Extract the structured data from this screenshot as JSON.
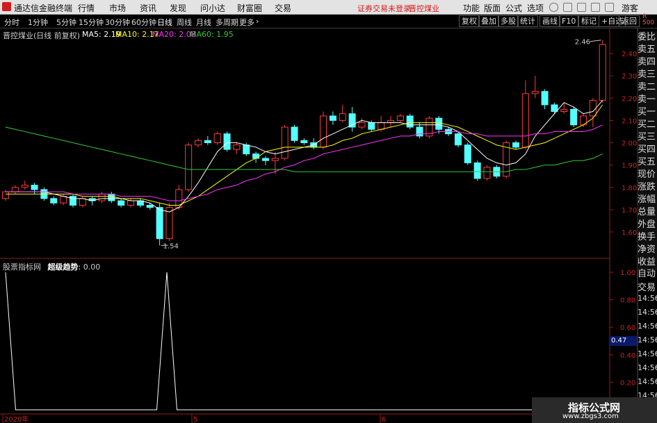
{
  "app": {
    "title": "通达信金融终端",
    "notice": "证券交易未登录",
    "stock_link": "晋控煤业"
  },
  "menu": [
    "行情",
    "市场",
    "资讯",
    "发现",
    "问小达",
    "财富圈",
    "交易"
  ],
  "menu_right": [
    "功能",
    "版面",
    "公式",
    "选项",
    "游客"
  ],
  "periods": [
    "分时",
    "1分钟",
    "5分钟",
    "15分钟",
    "30分钟",
    "60分钟",
    "日线",
    "周线",
    "月线",
    "多周期",
    "更多"
  ],
  "tools": [
    "复权",
    "叠加",
    "多股",
    "统计",
    "画线",
    "F10",
    "标记",
    "+自选",
    "返回"
  ],
  "rank": {
    "letter": "R",
    "num": "500"
  },
  "chart": {
    "title": "晋控煤业(日线 前复权)",
    "ma": [
      {
        "label": "MA5: 2.19",
        "color": "#ffffff"
      },
      {
        "label": "MA10: 2.17",
        "color": "#ffff00"
      },
      {
        "label": "MA20: 2.08",
        "color": "#ff33ff"
      },
      {
        "label": "MA60: 1.95",
        "color": "#33cc33"
      }
    ],
    "price_axis": [
      "2.40",
      "2.30",
      "2.20",
      "2.10",
      "2.00",
      "1.90",
      "1.80",
      "1.70",
      "1.60"
    ],
    "high_label": "2.46",
    "low_label": "1.54",
    "x_labels": [
      "2020年",
      "5",
      "6"
    ]
  },
  "indicator": {
    "title": "股票指标网",
    "name": "超级趋势",
    "value": "0.00",
    "axis": [
      "1.00",
      "0.80",
      "0.60",
      "0.40",
      "0.20"
    ],
    "cursor_value": "0.47",
    "values": [
      1,
      0,
      0,
      0,
      0,
      0,
      0,
      0,
      0,
      0,
      0,
      0,
      0,
      0,
      0,
      0,
      1,
      0,
      0,
      0,
      0,
      0,
      0,
      0,
      0,
      0,
      0,
      0,
      0,
      0,
      0,
      0,
      0,
      0,
      0,
      0,
      0,
      0,
      0,
      0,
      0,
      0,
      0,
      0,
      0,
      0,
      0,
      0,
      0,
      0,
      0,
      0,
      0,
      0,
      0,
      0,
      0,
      0
    ]
  },
  "side_panel": [
    "委比",
    "卖五",
    "卖四",
    "卖三",
    "卖二",
    "卖一",
    "买一",
    "买二",
    "买三",
    "买四",
    "买五",
    "现价",
    "涨跌",
    "涨幅",
    "总量",
    "外盘",
    "换手",
    "净资",
    "收益"
  ],
  "trade_panel": {
    "labels": [
      "自动",
      "交易"
    ],
    "times": [
      "14:56",
      "14:56",
      "14:56",
      "14:56",
      "14:56",
      "14:56",
      "14:56",
      "14:56"
    ]
  },
  "watermark": {
    "title": "指标公式网",
    "url": "www.zbgs3.com"
  },
  "chart_data": {
    "type": "candlestick",
    "ylim": [
      1.54,
      2.46
    ],
    "candles": [
      [
        1.75,
        1.78,
        1.79,
        1.74
      ],
      [
        1.78,
        1.8,
        1.81,
        1.77
      ],
      [
        1.8,
        1.81,
        1.83,
        1.79
      ],
      [
        1.81,
        1.79,
        1.82,
        1.77
      ],
      [
        1.79,
        1.75,
        1.8,
        1.74
      ],
      [
        1.75,
        1.73,
        1.76,
        1.72
      ],
      [
        1.73,
        1.76,
        1.77,
        1.72
      ],
      [
        1.76,
        1.72,
        1.77,
        1.71
      ],
      [
        1.72,
        1.75,
        1.76,
        1.71
      ],
      [
        1.75,
        1.74,
        1.76,
        1.72
      ],
      [
        1.74,
        1.77,
        1.78,
        1.73
      ],
      [
        1.77,
        1.74,
        1.78,
        1.73
      ],
      [
        1.74,
        1.72,
        1.75,
        1.71
      ],
      [
        1.72,
        1.74,
        1.75,
        1.71
      ],
      [
        1.74,
        1.72,
        1.75,
        1.71
      ],
      [
        1.72,
        1.71,
        1.73,
        1.7
      ],
      [
        1.71,
        1.57,
        1.73,
        1.54
      ],
      [
        1.57,
        1.71,
        1.73,
        1.56
      ],
      [
        1.71,
        1.79,
        1.81,
        1.7
      ],
      [
        1.79,
        1.99,
        2.0,
        1.78
      ],
      [
        1.99,
        2.01,
        2.02,
        1.98
      ],
      [
        2.01,
        2.0,
        2.03,
        1.99
      ],
      [
        2.0,
        2.04,
        2.05,
        1.99
      ],
      [
        2.04,
        1.97,
        2.05,
        1.96
      ],
      [
        1.97,
        1.99,
        2.0,
        1.95
      ],
      [
        1.99,
        1.95,
        2.0,
        1.94
      ],
      [
        1.95,
        1.93,
        1.96,
        1.91
      ],
      [
        1.93,
        1.92,
        1.94,
        1.9
      ],
      [
        1.92,
        1.93,
        1.96,
        1.86
      ],
      [
        1.93,
        2.07,
        2.08,
        1.92
      ],
      [
        2.07,
        2.01,
        2.08,
        2.0
      ],
      [
        2.01,
        2.0,
        2.02,
        1.99
      ],
      [
        2.0,
        1.98,
        2.02,
        1.97
      ],
      [
        1.98,
        2.12,
        2.14,
        1.97
      ],
      [
        2.12,
        2.1,
        2.14,
        2.08
      ],
      [
        2.1,
        2.13,
        2.17,
        2.09
      ],
      [
        2.13,
        2.07,
        2.16,
        2.05
      ],
      [
        2.07,
        2.09,
        2.11,
        2.06
      ],
      [
        2.09,
        2.06,
        2.1,
        2.05
      ],
      [
        2.06,
        2.09,
        2.12,
        2.05
      ],
      [
        2.09,
        2.1,
        2.12,
        2.07
      ],
      [
        2.1,
        2.12,
        2.13,
        2.09
      ],
      [
        2.12,
        2.07,
        2.13,
        2.06
      ],
      [
        2.07,
        2.03,
        2.09,
        2.02
      ],
      [
        2.03,
        2.11,
        2.12,
        2.02
      ],
      [
        2.11,
        2.06,
        2.12,
        2.04
      ],
      [
        2.06,
        2.04,
        2.07,
        2.03
      ],
      [
        2.04,
        1.99,
        2.05,
        1.98
      ],
      [
        1.99,
        1.91,
        2.0,
        1.9
      ],
      [
        1.91,
        1.84,
        1.92,
        1.83
      ],
      [
        1.84,
        1.89,
        1.9,
        1.83
      ],
      [
        1.89,
        1.85,
        1.9,
        1.84
      ],
      [
        1.85,
        2.0,
        2.01,
        1.84
      ],
      [
        2.0,
        1.98,
        2.01,
        1.97
      ],
      [
        1.98,
        2.22,
        2.28,
        1.97
      ],
      [
        2.22,
        2.23,
        2.3,
        2.2
      ],
      [
        2.23,
        2.17,
        2.24,
        2.15
      ],
      [
        2.17,
        2.14,
        2.18,
        2.13
      ],
      [
        2.14,
        2.15,
        2.18,
        2.13
      ],
      [
        2.15,
        2.08,
        2.16,
        2.07
      ],
      [
        2.08,
        2.12,
        2.13,
        2.07
      ],
      [
        2.12,
        2.19,
        2.2,
        2.07
      ],
      [
        2.19,
        2.44,
        2.46,
        2.18
      ]
    ],
    "ma_series": [
      {
        "name": "MA5",
        "color": "#ffffff",
        "values": [
          1.78,
          1.78,
          1.78,
          1.78,
          1.78,
          1.77,
          1.76,
          1.75,
          1.75,
          1.74,
          1.75,
          1.75,
          1.75,
          1.74,
          1.74,
          1.73,
          1.7,
          1.69,
          1.71,
          1.76,
          1.82,
          1.89,
          1.96,
          2.0,
          2.0,
          1.99,
          1.98,
          1.96,
          1.95,
          1.96,
          1.97,
          1.98,
          1.99,
          2.02,
          2.04,
          2.06,
          2.08,
          2.1,
          2.09,
          2.09,
          2.09,
          2.09,
          2.08,
          2.08,
          2.08,
          2.08,
          2.07,
          2.05,
          2.01,
          1.97,
          1.93,
          1.91,
          1.9,
          1.91,
          1.95,
          2.03,
          2.08,
          2.13,
          2.18,
          2.16,
          2.13,
          2.14,
          2.19
        ]
      },
      {
        "name": "MA10",
        "color": "#ffff00",
        "values": [
          1.77,
          1.77,
          1.77,
          1.77,
          1.77,
          1.77,
          1.77,
          1.77,
          1.76,
          1.76,
          1.76,
          1.76,
          1.75,
          1.75,
          1.75,
          1.74,
          1.73,
          1.72,
          1.72,
          1.74,
          1.76,
          1.79,
          1.82,
          1.85,
          1.88,
          1.91,
          1.93,
          1.96,
          1.97,
          1.98,
          1.98,
          1.98,
          1.98,
          1.98,
          1.99,
          2.01,
          2.02,
          2.04,
          2.05,
          2.06,
          2.07,
          2.08,
          2.09,
          2.09,
          2.09,
          2.09,
          2.08,
          2.07,
          2.05,
          2.03,
          2.01,
          1.99,
          1.98,
          1.97,
          1.98,
          1.99,
          2.0,
          2.02,
          2.04,
          2.06,
          2.08,
          2.11,
          2.17
        ]
      },
      {
        "name": "MA20",
        "color": "#ff33ff",
        "values": [
          1.78,
          1.78,
          1.78,
          1.78,
          1.78,
          1.78,
          1.78,
          1.77,
          1.77,
          1.77,
          1.77,
          1.77,
          1.76,
          1.76,
          1.76,
          1.76,
          1.75,
          1.74,
          1.74,
          1.75,
          1.76,
          1.77,
          1.79,
          1.8,
          1.81,
          1.83,
          1.84,
          1.86,
          1.87,
          1.89,
          1.9,
          1.92,
          1.93,
          1.95,
          1.96,
          1.97,
          1.98,
          1.99,
          2.0,
          2.01,
          2.02,
          2.03,
          2.03,
          2.04,
          2.04,
          2.05,
          2.05,
          2.05,
          2.04,
          2.04,
          2.03,
          2.03,
          2.03,
          2.03,
          2.03,
          2.04,
          2.04,
          2.05,
          2.05,
          2.05,
          2.05,
          2.06,
          2.08
        ]
      },
      {
        "name": "MA60",
        "color": "#33cc33",
        "values": [
          2.07,
          2.06,
          2.05,
          2.04,
          2.03,
          2.02,
          2.01,
          2.0,
          1.99,
          1.98,
          1.97,
          1.96,
          1.95,
          1.94,
          1.93,
          1.92,
          1.91,
          1.9,
          1.89,
          1.88,
          1.88,
          1.88,
          1.88,
          1.88,
          1.88,
          1.88,
          1.88,
          1.88,
          1.88,
          1.88,
          1.87,
          1.87,
          1.87,
          1.87,
          1.87,
          1.87,
          1.87,
          1.87,
          1.87,
          1.87,
          1.87,
          1.87,
          1.87,
          1.87,
          1.87,
          1.87,
          1.87,
          1.87,
          1.87,
          1.87,
          1.87,
          1.87,
          1.87,
          1.88,
          1.88,
          1.89,
          1.9,
          1.9,
          1.91,
          1.92,
          1.92,
          1.93,
          1.95
        ]
      }
    ]
  }
}
